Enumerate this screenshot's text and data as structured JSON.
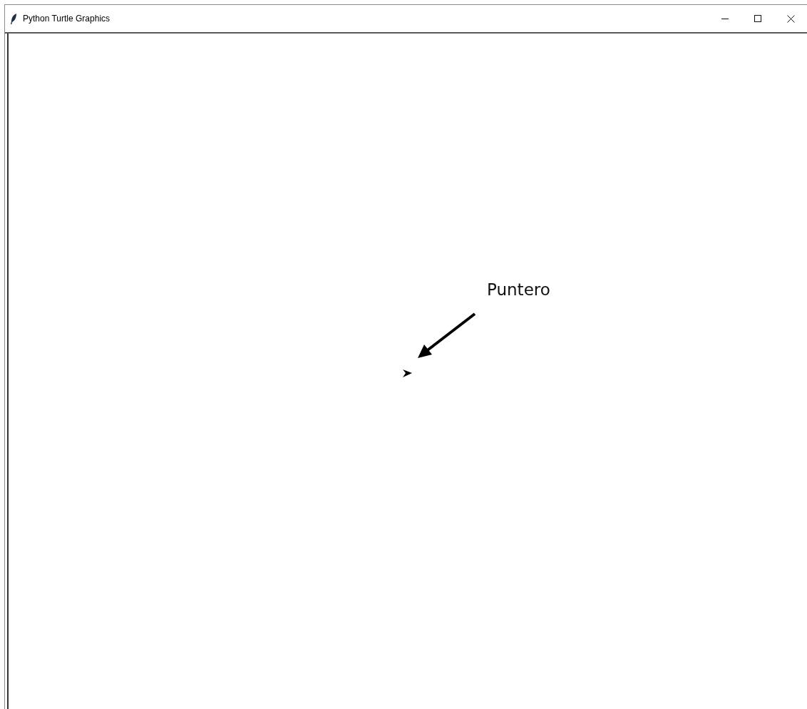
{
  "window": {
    "title": "Python Turtle Graphics"
  },
  "canvas": {
    "annotation": {
      "label": "Puntero"
    }
  }
}
